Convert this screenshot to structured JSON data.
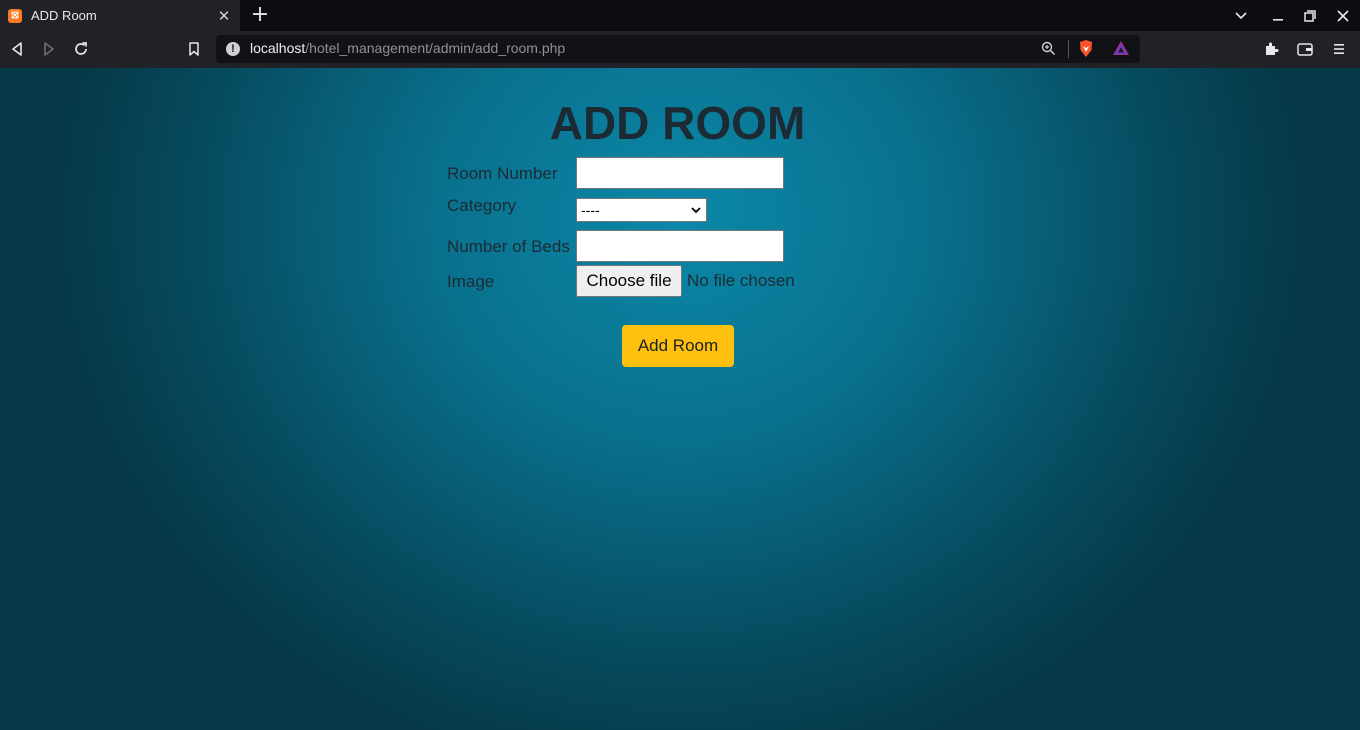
{
  "browser": {
    "tab_title": "ADD Room",
    "favicon_glyph": "⊠",
    "url_host": "localhost",
    "url_path": "/hotel_management/admin/add_room.php"
  },
  "colors": {
    "accent_button": "#fdc00f",
    "page_bg_center": "#0b88a8",
    "page_bg_edge": "#053947"
  },
  "form": {
    "title": "ADD ROOM",
    "room_number_label": "Room Number",
    "room_number_value": "",
    "category_label": "Category",
    "category_selected": "----",
    "beds_label": "Number of Beds",
    "beds_value": "",
    "image_label": "Image",
    "file_button": "Choose file",
    "file_status": "No file chosen",
    "submit_label": "Add Room"
  }
}
